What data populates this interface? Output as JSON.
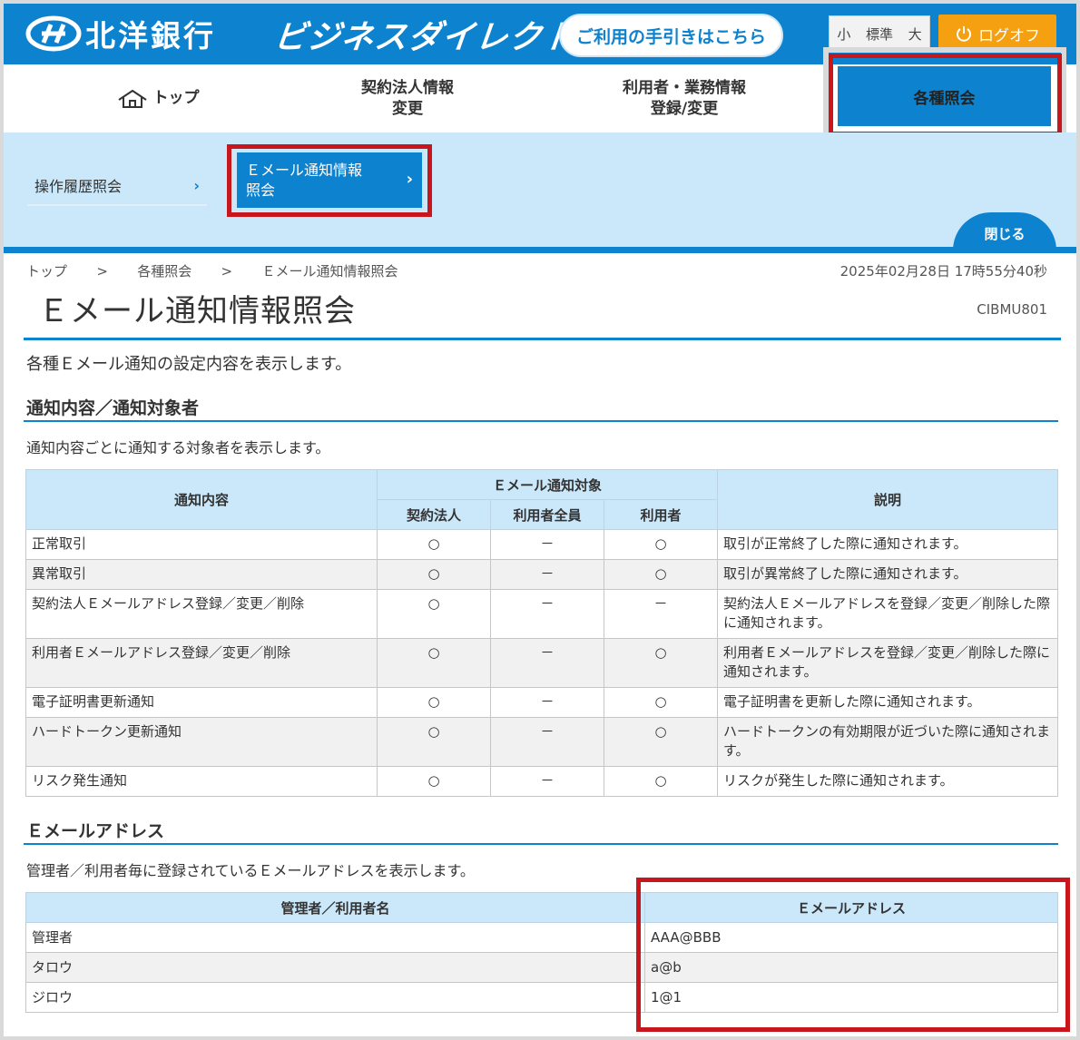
{
  "header": {
    "bank_name": "北洋銀行",
    "service_name": "ビジネスダイレクト",
    "guide_button": "ご利用の手引きはこちら",
    "font_size": {
      "small": "小",
      "normal": "標準",
      "large": "大"
    },
    "logoff": "ログオフ"
  },
  "nav": {
    "top": "トップ",
    "corp_line1": "契約法人情報",
    "corp_line2": "変更",
    "user_line1": "利用者・業務情報",
    "user_line2": "登録/変更",
    "inquiry": "各種照会"
  },
  "submenu": {
    "history": "操作履歴照会",
    "email_line1": "Ｅメール通知情報",
    "email_line2": "照会",
    "close": "閉じる"
  },
  "breadcrumb": {
    "items": [
      "トップ",
      "各種照会",
      "Ｅメール通知情報照会"
    ],
    "separator": ">"
  },
  "timestamp": "2025年02月28日 17時55分40秒",
  "page": {
    "title": "Ｅメール通知情報照会",
    "screen_id": "CIBMU801",
    "lead": "各種Ｅメール通知の設定内容を表示します。"
  },
  "notify_section": {
    "heading": "通知内容／通知対象者",
    "desc": "通知内容ごとに通知する対象者を表示します。",
    "headers": {
      "content": "通知内容",
      "target_group": "Ｅメール通知対象",
      "corp": "契約法人",
      "all_users": "利用者全員",
      "user": "利用者",
      "description": "説明"
    },
    "rows": [
      {
        "content": "正常取引",
        "corp": "○",
        "all_users": "－",
        "user": "○",
        "description": "取引が正常終了した際に通知されます。"
      },
      {
        "content": "異常取引",
        "corp": "○",
        "all_users": "－",
        "user": "○",
        "description": "取引が異常終了した際に通知されます。"
      },
      {
        "content": "契約法人Ｅメールアドレス登録／変更／削除",
        "corp": "○",
        "all_users": "－",
        "user": "－",
        "description": "契約法人Ｅメールアドレスを登録／変更／削除した際に通知されます。"
      },
      {
        "content": "利用者Ｅメールアドレス登録／変更／削除",
        "corp": "○",
        "all_users": "－",
        "user": "○",
        "description": "利用者Ｅメールアドレスを登録／変更／削除した際に通知されます。"
      },
      {
        "content": "電子証明書更新通知",
        "corp": "○",
        "all_users": "－",
        "user": "○",
        "description": "電子証明書を更新した際に通知されます。"
      },
      {
        "content": "ハードトークン更新通知",
        "corp": "○",
        "all_users": "－",
        "user": "○",
        "description": "ハードトークンの有効期限が近づいた際に通知されます。"
      },
      {
        "content": "リスク発生通知",
        "corp": "○",
        "all_users": "－",
        "user": "○",
        "description": "リスクが発生した際に通知されます。"
      }
    ]
  },
  "email_section": {
    "heading": "Ｅメールアドレス",
    "desc": "管理者／利用者毎に登録されているＥメールアドレスを表示します。",
    "headers": {
      "name": "管理者／利用者名",
      "email": "Ｅメールアドレス"
    },
    "rows": [
      {
        "name": "管理者",
        "email": "AAA@BBB"
      },
      {
        "name": "タロウ",
        "email": "a@b"
      },
      {
        "name": "ジロウ",
        "email": "1@1"
      }
    ]
  },
  "colors": {
    "primary": "#0d82cf",
    "submenu_bg": "#cbe8fa",
    "logoff": "#f5a011",
    "highlight": "#c8161d"
  }
}
